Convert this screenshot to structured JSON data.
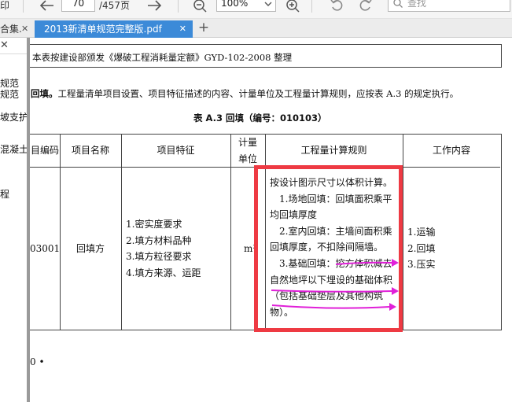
{
  "toolbar": {
    "print_label": "印",
    "page_current": "70",
    "page_total": "/457页",
    "zoom": "100%",
    "search_placeholder": "查找"
  },
  "tabs": {
    "inactive_label": "合集.",
    "active_label": "2013新清单规范完整版.pdf",
    "close_glyph": "✕",
    "add_glyph": "+"
  },
  "sidebar": {
    "close_glyph": "✕",
    "items": [
      "规范",
      "规范",
      "坡支护",
      "混凝土",
      "程"
    ]
  },
  "document": {
    "note": "本表按建设部颁发《爆破工程消耗量定额》GYD-102-2008 整理",
    "para_bold": "回填。",
    "para_text": "工程量清单项目设置、项目特征描述的内容、计量单位及工程量计算规则，应按表 A.3 的规定执行。",
    "table_title": "表 A.3  回填（编号：010103）",
    "headers": {
      "code": "目编码",
      "name": "项目名称",
      "feature": "项目特征",
      "unit_1": "计量",
      "unit_2": "单位",
      "rule": "工程量计算规则",
      "work": "工作内容"
    },
    "row": {
      "code": "03001",
      "name": "回填方",
      "features": [
        "1.密实度要求",
        "2.填方材料品种",
        "3.填方粒径要求",
        "4.填方来源、运距"
      ],
      "unit": "m³",
      "rule_lines": [
        "按设计图示尺寸以体积计算。",
        "　1.场地回填：回填面积乘平",
        "均回填厚度",
        "　2.室内回填：主墙间面积乘",
        "回填厚度，不扣除间隔墙。",
        "　3.基础回填：挖方体积减去",
        "自然地坪以下埋设的基础体积",
        "（包括基础垫层及其他构筑",
        "物）。"
      ],
      "work": [
        "1.运输",
        "2.回填",
        "3.压实"
      ]
    },
    "page_number": "0 •"
  },
  "colors": {
    "accent_tab": "#3c8ad8",
    "highlight_frame": "#ee3a43",
    "annotation_arrow": "#e020d8"
  }
}
